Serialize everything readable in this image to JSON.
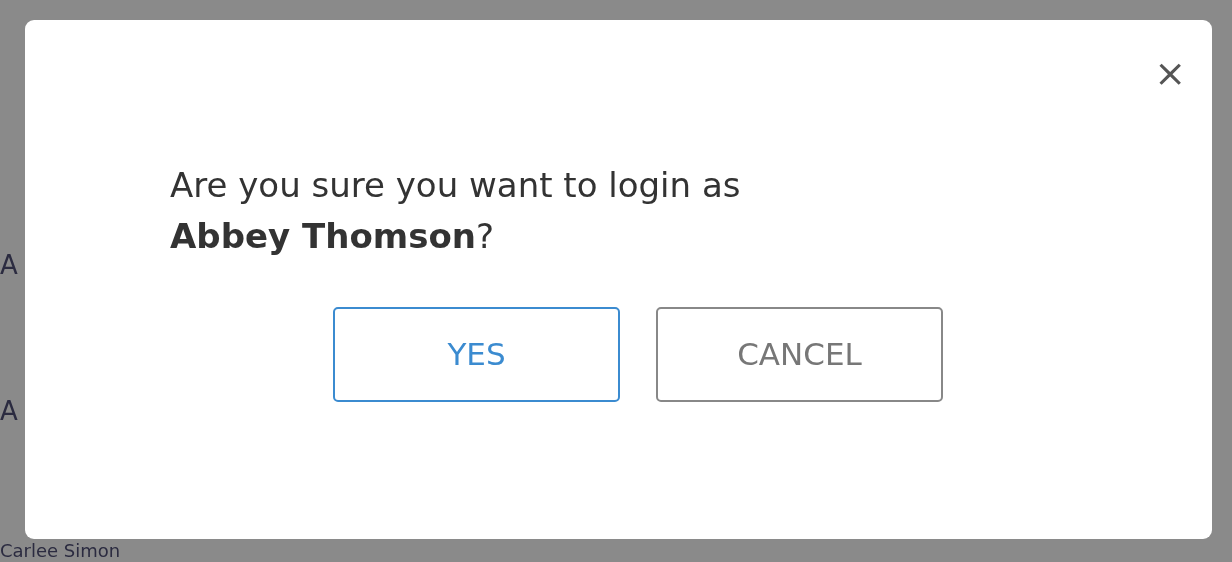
{
  "background": {
    "rows": [
      {
        "name": "A"
      },
      {
        "name": "A"
      },
      {
        "name": "Carlee Simon"
      }
    ]
  },
  "dialog": {
    "close": "×",
    "message": "Are you sure you want to login as **Abbey Thomson**?",
    "buttons": [
      {
        "label": "YES",
        "kind": "primary"
      },
      {
        "label": "CANCEL",
        "kind": "secondary"
      }
    ]
  }
}
